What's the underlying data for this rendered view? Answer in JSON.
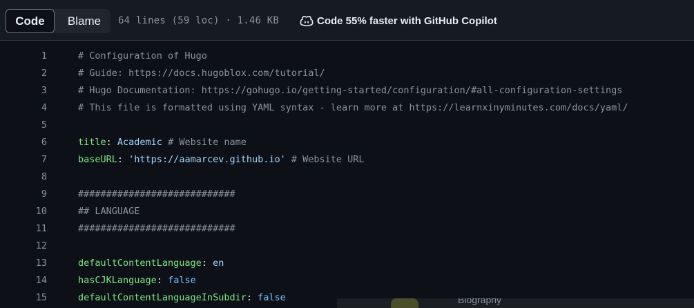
{
  "toolbar": {
    "code_label": "Code",
    "blame_label": "Blame",
    "file_info": "64 lines (59 loc) · 1.46 KB",
    "copilot_label": "Code 55% faster with GitHub Copilot"
  },
  "code": {
    "lines": [
      {
        "n": "1",
        "parts": [
          {
            "t": "# Configuration of Hugo",
            "c": "cm"
          }
        ]
      },
      {
        "n": "2",
        "parts": [
          {
            "t": "# Guide: https://docs.hugoblox.com/tutorial/",
            "c": "cm"
          }
        ]
      },
      {
        "n": "3",
        "parts": [
          {
            "t": "# Hugo Documentation: https://gohugo.io/getting-started/configuration/#all-configuration-settings",
            "c": "cm"
          }
        ]
      },
      {
        "n": "4",
        "parts": [
          {
            "t": "# This file is formatted using YAML syntax - learn more at https://learnxinyminutes.com/docs/yaml/",
            "c": "cm"
          }
        ]
      },
      {
        "n": "5",
        "parts": []
      },
      {
        "n": "6",
        "parts": [
          {
            "t": "title",
            "c": "key"
          },
          {
            "t": ": ",
            "c": "pl"
          },
          {
            "t": "Academic",
            "c": "val"
          },
          {
            "t": " # Website name",
            "c": "cm"
          }
        ]
      },
      {
        "n": "7",
        "parts": [
          {
            "t": "baseURL",
            "c": "key"
          },
          {
            "t": ": ",
            "c": "pl"
          },
          {
            "t": "'https://aamarcev.github.io'",
            "c": "val"
          },
          {
            "t": " # Website URL",
            "c": "cm"
          }
        ]
      },
      {
        "n": "8",
        "parts": []
      },
      {
        "n": "9",
        "parts": [
          {
            "t": "############################",
            "c": "cm"
          }
        ]
      },
      {
        "n": "10",
        "parts": [
          {
            "t": "## LANGUAGE",
            "c": "cm"
          }
        ]
      },
      {
        "n": "11",
        "parts": [
          {
            "t": "############################",
            "c": "cm"
          }
        ]
      },
      {
        "n": "12",
        "parts": []
      },
      {
        "n": "13",
        "parts": [
          {
            "t": "defaultContentLanguage",
            "c": "key"
          },
          {
            "t": ": ",
            "c": "pl"
          },
          {
            "t": "en",
            "c": "val"
          }
        ]
      },
      {
        "n": "14",
        "parts": [
          {
            "t": "hasCJKLanguage",
            "c": "key"
          },
          {
            "t": ": ",
            "c": "pl"
          },
          {
            "t": "false",
            "c": "const"
          }
        ]
      },
      {
        "n": "15",
        "parts": [
          {
            "t": "defaultContentLanguageInSubdir",
            "c": "key"
          },
          {
            "t": ": ",
            "c": "pl"
          },
          {
            "t": "false",
            "c": "const"
          }
        ]
      }
    ]
  },
  "overlay": {
    "text": "Biography"
  },
  "icons": {
    "copilot": "copilot-icon"
  },
  "colors": {
    "background": "#0d1117",
    "comment": "#8b949e",
    "key": "#7ee787",
    "string": "#a5d6ff",
    "constant": "#79c0ff"
  }
}
